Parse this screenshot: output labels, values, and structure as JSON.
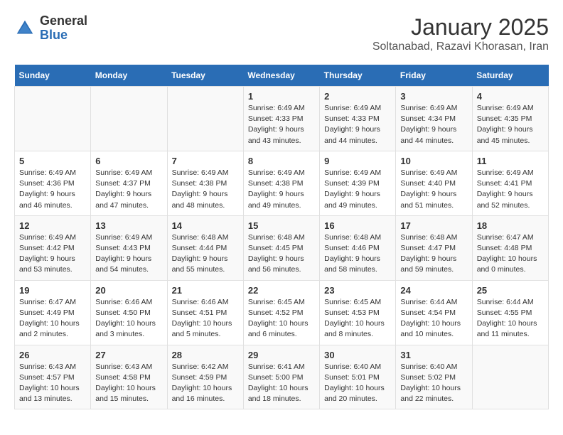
{
  "logo": {
    "general": "General",
    "blue": "Blue"
  },
  "title": "January 2025",
  "subtitle": "Soltanabad, Razavi Khorasan, Iran",
  "weekdays": [
    "Sunday",
    "Monday",
    "Tuesday",
    "Wednesday",
    "Thursday",
    "Friday",
    "Saturday"
  ],
  "weeks": [
    [
      {
        "day": "",
        "info": ""
      },
      {
        "day": "",
        "info": ""
      },
      {
        "day": "",
        "info": ""
      },
      {
        "day": "1",
        "info": "Sunrise: 6:49 AM\nSunset: 4:33 PM\nDaylight: 9 hours and 43 minutes."
      },
      {
        "day": "2",
        "info": "Sunrise: 6:49 AM\nSunset: 4:33 PM\nDaylight: 9 hours and 44 minutes."
      },
      {
        "day": "3",
        "info": "Sunrise: 6:49 AM\nSunset: 4:34 PM\nDaylight: 9 hours and 44 minutes."
      },
      {
        "day": "4",
        "info": "Sunrise: 6:49 AM\nSunset: 4:35 PM\nDaylight: 9 hours and 45 minutes."
      }
    ],
    [
      {
        "day": "5",
        "info": "Sunrise: 6:49 AM\nSunset: 4:36 PM\nDaylight: 9 hours and 46 minutes."
      },
      {
        "day": "6",
        "info": "Sunrise: 6:49 AM\nSunset: 4:37 PM\nDaylight: 9 hours and 47 minutes."
      },
      {
        "day": "7",
        "info": "Sunrise: 6:49 AM\nSunset: 4:38 PM\nDaylight: 9 hours and 48 minutes."
      },
      {
        "day": "8",
        "info": "Sunrise: 6:49 AM\nSunset: 4:38 PM\nDaylight: 9 hours and 49 minutes."
      },
      {
        "day": "9",
        "info": "Sunrise: 6:49 AM\nSunset: 4:39 PM\nDaylight: 9 hours and 49 minutes."
      },
      {
        "day": "10",
        "info": "Sunrise: 6:49 AM\nSunset: 4:40 PM\nDaylight: 9 hours and 51 minutes."
      },
      {
        "day": "11",
        "info": "Sunrise: 6:49 AM\nSunset: 4:41 PM\nDaylight: 9 hours and 52 minutes."
      }
    ],
    [
      {
        "day": "12",
        "info": "Sunrise: 6:49 AM\nSunset: 4:42 PM\nDaylight: 9 hours and 53 minutes."
      },
      {
        "day": "13",
        "info": "Sunrise: 6:49 AM\nSunset: 4:43 PM\nDaylight: 9 hours and 54 minutes."
      },
      {
        "day": "14",
        "info": "Sunrise: 6:48 AM\nSunset: 4:44 PM\nDaylight: 9 hours and 55 minutes."
      },
      {
        "day": "15",
        "info": "Sunrise: 6:48 AM\nSunset: 4:45 PM\nDaylight: 9 hours and 56 minutes."
      },
      {
        "day": "16",
        "info": "Sunrise: 6:48 AM\nSunset: 4:46 PM\nDaylight: 9 hours and 58 minutes."
      },
      {
        "day": "17",
        "info": "Sunrise: 6:48 AM\nSunset: 4:47 PM\nDaylight: 9 hours and 59 minutes."
      },
      {
        "day": "18",
        "info": "Sunrise: 6:47 AM\nSunset: 4:48 PM\nDaylight: 10 hours and 0 minutes."
      }
    ],
    [
      {
        "day": "19",
        "info": "Sunrise: 6:47 AM\nSunset: 4:49 PM\nDaylight: 10 hours and 2 minutes."
      },
      {
        "day": "20",
        "info": "Sunrise: 6:46 AM\nSunset: 4:50 PM\nDaylight: 10 hours and 3 minutes."
      },
      {
        "day": "21",
        "info": "Sunrise: 6:46 AM\nSunset: 4:51 PM\nDaylight: 10 hours and 5 minutes."
      },
      {
        "day": "22",
        "info": "Sunrise: 6:45 AM\nSunset: 4:52 PM\nDaylight: 10 hours and 6 minutes."
      },
      {
        "day": "23",
        "info": "Sunrise: 6:45 AM\nSunset: 4:53 PM\nDaylight: 10 hours and 8 minutes."
      },
      {
        "day": "24",
        "info": "Sunrise: 6:44 AM\nSunset: 4:54 PM\nDaylight: 10 hours and 10 minutes."
      },
      {
        "day": "25",
        "info": "Sunrise: 6:44 AM\nSunset: 4:55 PM\nDaylight: 10 hours and 11 minutes."
      }
    ],
    [
      {
        "day": "26",
        "info": "Sunrise: 6:43 AM\nSunset: 4:57 PM\nDaylight: 10 hours and 13 minutes."
      },
      {
        "day": "27",
        "info": "Sunrise: 6:43 AM\nSunset: 4:58 PM\nDaylight: 10 hours and 15 minutes."
      },
      {
        "day": "28",
        "info": "Sunrise: 6:42 AM\nSunset: 4:59 PM\nDaylight: 10 hours and 16 minutes."
      },
      {
        "day": "29",
        "info": "Sunrise: 6:41 AM\nSunset: 5:00 PM\nDaylight: 10 hours and 18 minutes."
      },
      {
        "day": "30",
        "info": "Sunrise: 6:40 AM\nSunset: 5:01 PM\nDaylight: 10 hours and 20 minutes."
      },
      {
        "day": "31",
        "info": "Sunrise: 6:40 AM\nSunset: 5:02 PM\nDaylight: 10 hours and 22 minutes."
      },
      {
        "day": "",
        "info": ""
      }
    ]
  ]
}
